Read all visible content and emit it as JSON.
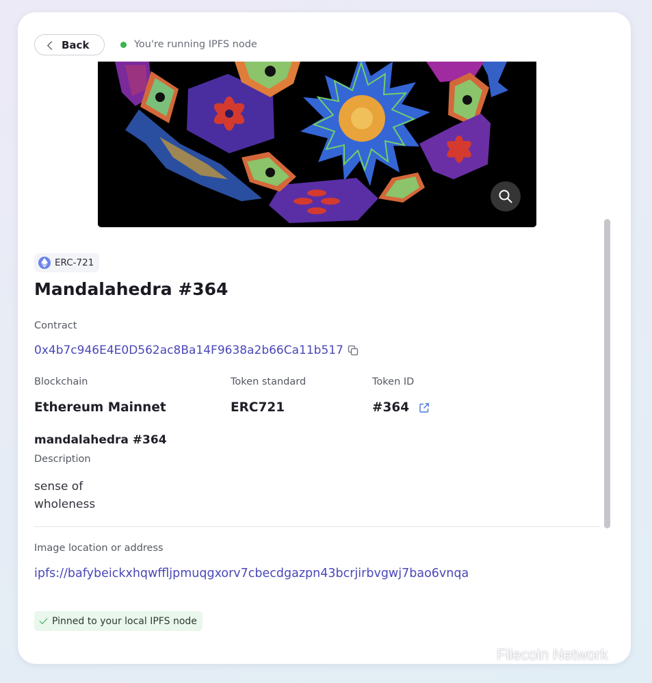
{
  "header": {
    "back_label": "Back",
    "node_status": "You're running IPFS node",
    "status_color": "#3ab54a"
  },
  "nft": {
    "standard_chip": "ERC-721",
    "title": "Mandalahedra #364",
    "contract_label": "Contract",
    "contract_address": "0x4b7c946E4E0D562ac8Ba14F9638a2b66Ca11b517",
    "blockchain_label": "Blockchain",
    "blockchain_value": "Ethereum Mainnet",
    "token_standard_label": "Token standard",
    "token_standard_value": "ERC721",
    "token_id_label": "Token ID",
    "token_id_value": "#364",
    "name": "mandalahedra #364",
    "description_label": "Description",
    "description": "sense of wholeness",
    "image_location_label": "Image location or address",
    "image_address": "ipfs://bafybeickxhqwffljpmuqgxorv7cbecdgazpn43bcrjirbvgwj7bao6vnqa",
    "pinned_status": "Pinned to your local IPFS node"
  },
  "watermark": {
    "text": "Filecoin Network"
  },
  "colors": {
    "link": "#4a47b8",
    "pinned_bg": "#e9f7ec",
    "eth_badge": "#6a84e8"
  }
}
